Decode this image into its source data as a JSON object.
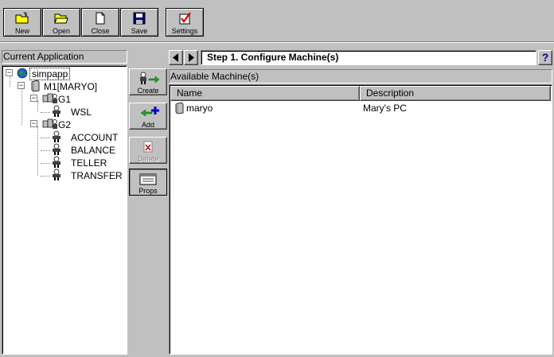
{
  "toolbar": {
    "buttons": [
      {
        "label": "New",
        "icon": "new-folder-icon"
      },
      {
        "label": "Open",
        "icon": "open-folder-icon"
      },
      {
        "label": "Close",
        "icon": "close-document-icon"
      },
      {
        "label": "Save",
        "icon": "floppy-disk-icon"
      },
      {
        "label": "Settings",
        "icon": "checkmark-clipboard-icon"
      }
    ]
  },
  "left_panel": {
    "header": "Current Application",
    "tree": {
      "root": "simpapp",
      "machine": "M1[MARYO]",
      "group1": "G1",
      "group1_children": [
        "WSL"
      ],
      "group2": "G2",
      "group2_children": [
        "ACCOUNT",
        "BALANCE",
        "TELLER",
        "TRANSFER"
      ]
    }
  },
  "side_buttons": [
    {
      "label": "Create",
      "icon": "create-arrow-icon"
    },
    {
      "label": "Add",
      "icon": "add-plus-icon"
    },
    {
      "label": "Delete",
      "icon": "delete-x-icon"
    },
    {
      "label": "Props",
      "icon": "properties-icon"
    }
  ],
  "step": {
    "title": "Step 1. Configure Machine(s)",
    "help": "?"
  },
  "list": {
    "label": "Available Machine(s)",
    "columns": [
      "Name",
      "Description"
    ],
    "rows": [
      {
        "name": "maryo",
        "description": "Mary's PC"
      }
    ]
  },
  "colors": {
    "window_bg": "#c0c0c0",
    "panel_bg": "#ffffff",
    "help_icon": "#00008b"
  }
}
